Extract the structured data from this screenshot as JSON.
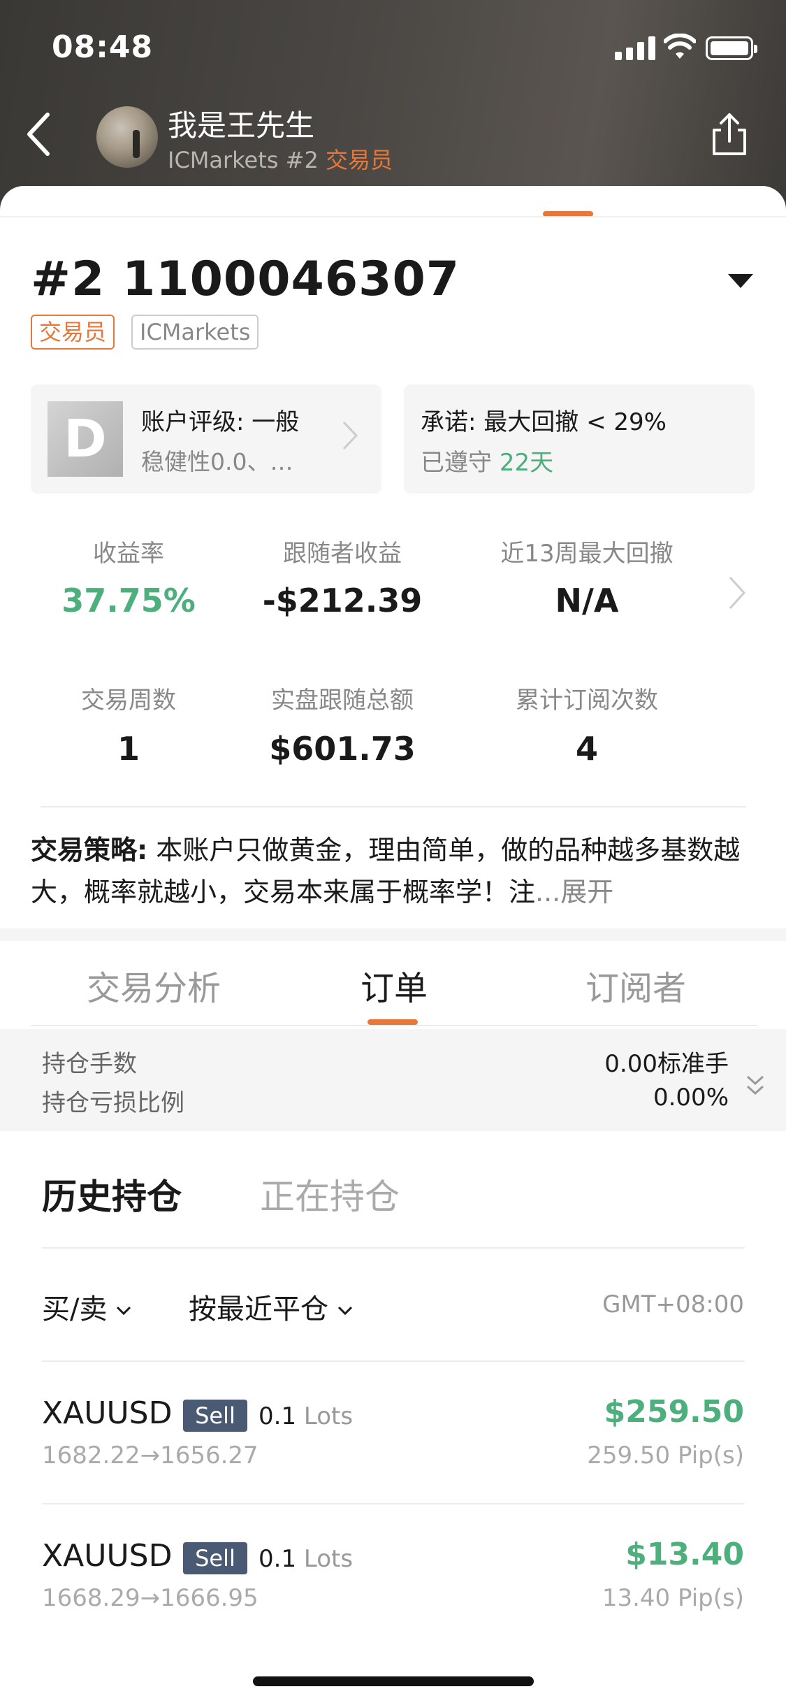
{
  "status_bar": {
    "time": "08:48"
  },
  "header": {
    "user_name": "我是王先生",
    "broker_rank": "ICMarkets #2 ",
    "role": "交易员"
  },
  "account": {
    "title": "#2 1100046307",
    "tag_trader": "交易员",
    "tag_broker": "ICMarkets"
  },
  "rating": {
    "grade": "D",
    "line1": "账户评级: 一般",
    "line2": "稳健性0.0、…"
  },
  "promise": {
    "line1": "承诺: 最大回撤 < 29%",
    "kept_label": "已遵守 ",
    "kept_days": "22天"
  },
  "stats": [
    {
      "label": "收益率",
      "value": "37.75%"
    },
    {
      "label": "跟随者收益",
      "value": "-$212.39"
    },
    {
      "label": "近13周最大回撤",
      "value": "N/A"
    },
    {
      "label": "交易周数",
      "value": "1"
    },
    {
      "label": "实盘跟随总额",
      "value": "$601.73"
    },
    {
      "label": "累计订阅次数",
      "value": "4"
    }
  ],
  "strategy": {
    "label": "交易策略:",
    "text": " 本账户只做黄金，理由简单，做的品种越多基数越大，概率就越小，交易本来属于概率学！注",
    "ellipsis": "...",
    "expand": "展开"
  },
  "tabs": [
    {
      "label": "交易分析"
    },
    {
      "label": "订单"
    },
    {
      "label": "订阅者"
    }
  ],
  "positions": {
    "lots_label": "持仓手数",
    "lots_value": "0.00标准手",
    "ratio_label": "持仓亏损比例",
    "ratio_value": "0.00%"
  },
  "sub_tabs": [
    {
      "label": "历史持仓"
    },
    {
      "label": "正在持仓"
    }
  ],
  "filters": {
    "side": "买/卖",
    "sort": "按最近平仓",
    "timezone": "GMT+08:00"
  },
  "orders": [
    {
      "symbol": "XAUUSD",
      "side": "Sell",
      "lots": "0.1",
      "lots_unit": " Lots",
      "prices": "1682.22→1656.27",
      "profit": "$259.50",
      "pips": "259.50 Pip(s)"
    },
    {
      "symbol": "XAUUSD",
      "side": "Sell",
      "lots": "0.1",
      "lots_unit": " Lots",
      "prices": "1668.29→1666.95",
      "profit": "$13.40",
      "pips": "13.40 Pip(s)"
    }
  ],
  "colors": {
    "accent": "#e8783a",
    "positive": "#4caf7c",
    "badge": "#4a5a73"
  }
}
